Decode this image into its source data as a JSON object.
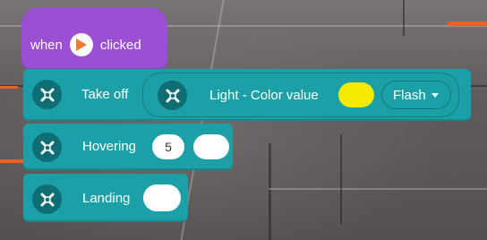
{
  "hat": {
    "when_label": "when",
    "clicked_label": "clicked"
  },
  "takeoff": {
    "label": "Take off",
    "light_label": "Light - Color value",
    "color": "#f5e900",
    "mode": "Flash"
  },
  "hovering": {
    "label": "Hovering",
    "value": "5"
  },
  "landing": {
    "label": "Landing"
  },
  "colors": {
    "event": "#9b4fd3",
    "drone": "#1aa0a6",
    "accent_bg": "#e6612a"
  }
}
